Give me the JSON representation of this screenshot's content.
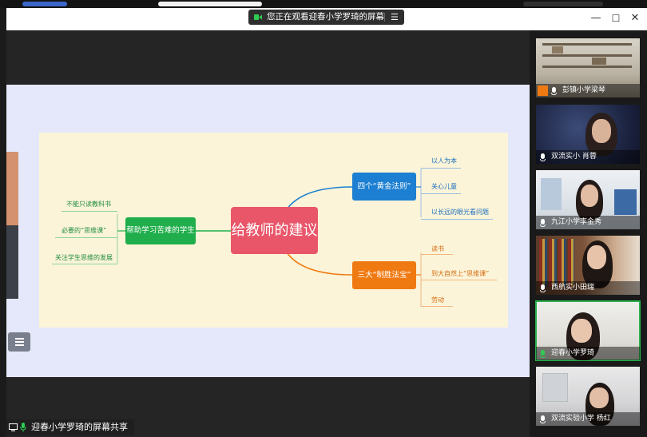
{
  "banner": {
    "text": "您正在观看迎春小学罗琦的屏幕",
    "menu_icon": "menu-icon",
    "camera_icon": "camera-icon",
    "accent": "#2ecc52"
  },
  "window_controls": {
    "minimize": "—",
    "maximize": "☐",
    "close": "✕"
  },
  "mindmap": {
    "center": "给教师的建议",
    "left_branch": {
      "label": "帮助学习苦难的学生",
      "items": [
        "不能只读教科书",
        "必要的“思维课”",
        "关注学生思维的发展"
      ]
    },
    "top_branch": {
      "label": "四个“黄金法则”",
      "items": [
        "以人为本",
        "关心儿童",
        "以长远的眼光看问题"
      ]
    },
    "bottom_branch": {
      "label": "三大“制胜法宝”",
      "items": [
        "读书",
        "到大自然上“思维课”",
        "劳动"
      ]
    },
    "colors": {
      "center": "#e9566a",
      "left": "#1fae4b",
      "top": "#1c7fd1",
      "bottom": "#f07a12",
      "canvas": "#fbf4d8"
    }
  },
  "share_label": "迎春小学罗琦的屏幕共享",
  "participants": [
    {
      "name": "彭镇小学梁琴",
      "mic": "muted",
      "has_avatar_badge": true
    },
    {
      "name": "双流实小 肖蓉",
      "mic": "muted"
    },
    {
      "name": "九江小学李金秀",
      "mic": "on"
    },
    {
      "name": "西航实小田瑞",
      "mic": "on"
    },
    {
      "name": "迎春小学罗琦",
      "mic": "speaking",
      "active": true
    },
    {
      "name": "双流实验小学 杨红",
      "mic": "on"
    }
  ]
}
